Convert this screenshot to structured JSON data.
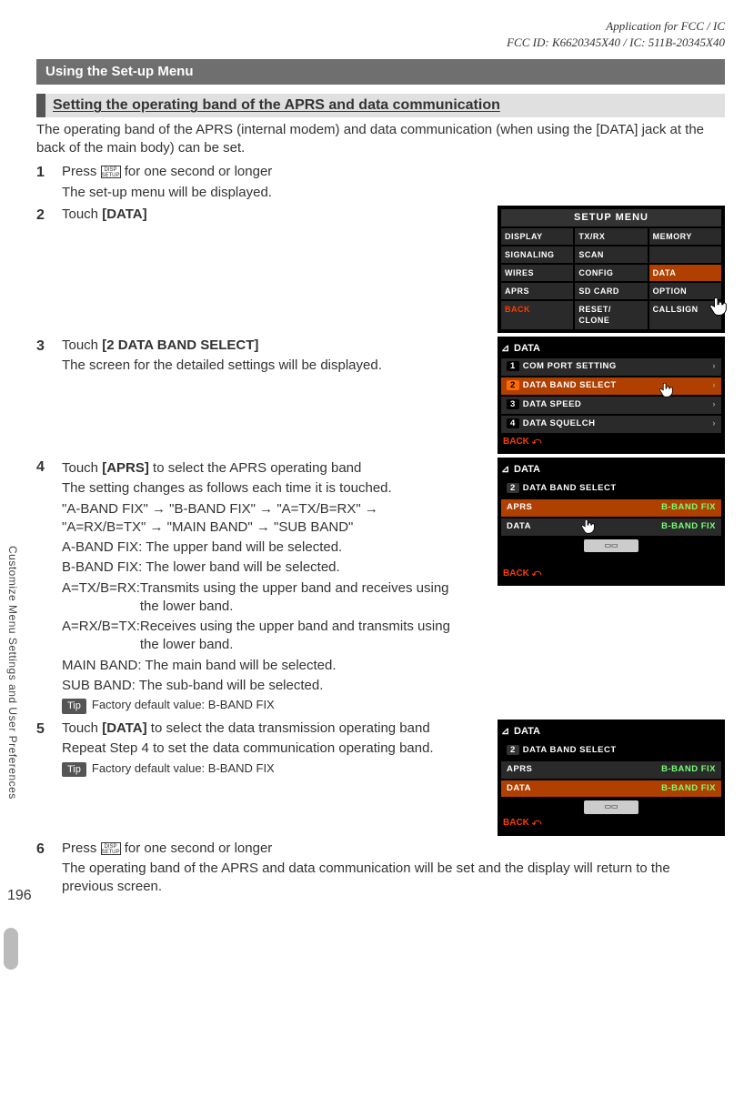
{
  "header": {
    "line1": "Application for FCC / IC",
    "line2": "FCC ID: K6620345X40 / IC: 511B-20345X40"
  },
  "banner": "Using the Set-up Menu",
  "section_title": "Setting the operating band of the APRS and data communication",
  "intro": "The operating band of the APRS (internal modem) and data communication (when using the [DATA] jack at the back of the main body) can be set.",
  "steps": {
    "s1": {
      "line1_a": "Press ",
      "line1_b": " for one second or longer",
      "line2": "The set-up menu will be displayed."
    },
    "s2": {
      "line1_a": "Touch ",
      "bold": "[DATA]"
    },
    "s3": {
      "line1_a": "Touch ",
      "bold": "[2 DATA BAND SELECT]",
      "line2": "The screen for the detailed settings will be displayed."
    },
    "s4": {
      "line1_a": "Touch ",
      "bold": "[APRS]",
      "line1_b": " to select the APRS operating band",
      "line2": "The setting changes as follows each time it is touched.",
      "seq": "\"A-BAND FIX\" → \"B-BAND FIX\" → \"A=TX/B=RX\" → \"A=RX/B=TX\" → \"MAIN BAND\" → \"SUB BAND\"",
      "d1": "A-BAND FIX: The upper band will be selected.",
      "d2": "B-BAND FIX: The lower band will be selected.",
      "d3l": "A=TX/B=RX: ",
      "d3b": "Transmits using the upper band and receives using the lower band.",
      "d4l": "A=RX/B=TX: ",
      "d4b": "Receives using the upper band and transmits using the lower band.",
      "d5": "MAIN BAND: The main band will be selected.",
      "d6": "SUB BAND: The sub-band will be selected.",
      "tip": "Tip",
      "tiptext": "Factory default value: B-BAND FIX"
    },
    "s5": {
      "line1_a": "Touch ",
      "bold": "[DATA]",
      "line1_b": " to select the data transmission operating band",
      "line2": "Repeat Step 4 to set the data communication operating band.",
      "tip": "Tip",
      "tiptext": "Factory default value: B-BAND FIX"
    },
    "s6": {
      "line1_a": "Press ",
      "line1_b": " for one second or longer",
      "line2": "The operating band of the APRS and data communication will be set and the display will return to the previous screen."
    }
  },
  "disp_label": "DISP\nSETUP",
  "shot1": {
    "title": "SETUP MENU",
    "cells": [
      [
        "DISPLAY",
        "TX/RX",
        "MEMORY"
      ],
      [
        "SIGNALING",
        "SCAN",
        ""
      ],
      [
        "WIRES",
        "CONFIG",
        "DATA"
      ],
      [
        "APRS",
        "SD CARD",
        "OPTION"
      ],
      [
        "BACK",
        "RESET/\nCLONE",
        "CALLSIGN"
      ]
    ]
  },
  "shot2": {
    "top": "DATA",
    "rows": [
      {
        "n": "1",
        "t": "COM PORT SETTING"
      },
      {
        "n": "2",
        "t": "DATA BAND SELECT"
      },
      {
        "n": "3",
        "t": "DATA SPEED"
      },
      {
        "n": "4",
        "t": "DATA SQUELCH"
      }
    ],
    "back": "BACK"
  },
  "shot3": {
    "top": "DATA",
    "header": {
      "n": "2",
      "t": "DATA BAND SELECT"
    },
    "kv": [
      {
        "k": "APRS",
        "v": "B-BAND FIX"
      },
      {
        "k": "DATA",
        "v": "B-BAND FIX"
      }
    ],
    "back": "BACK"
  },
  "shot4": {
    "top": "DATA",
    "header": {
      "n": "2",
      "t": "DATA BAND SELECT"
    },
    "kv": [
      {
        "k": "APRS",
        "v": "B-BAND FIX"
      },
      {
        "k": "DATA",
        "v": "B-BAND FIX"
      }
    ],
    "back": "BACK"
  },
  "sidetab": "Customize Menu Settings and User Preferences",
  "page": "196"
}
